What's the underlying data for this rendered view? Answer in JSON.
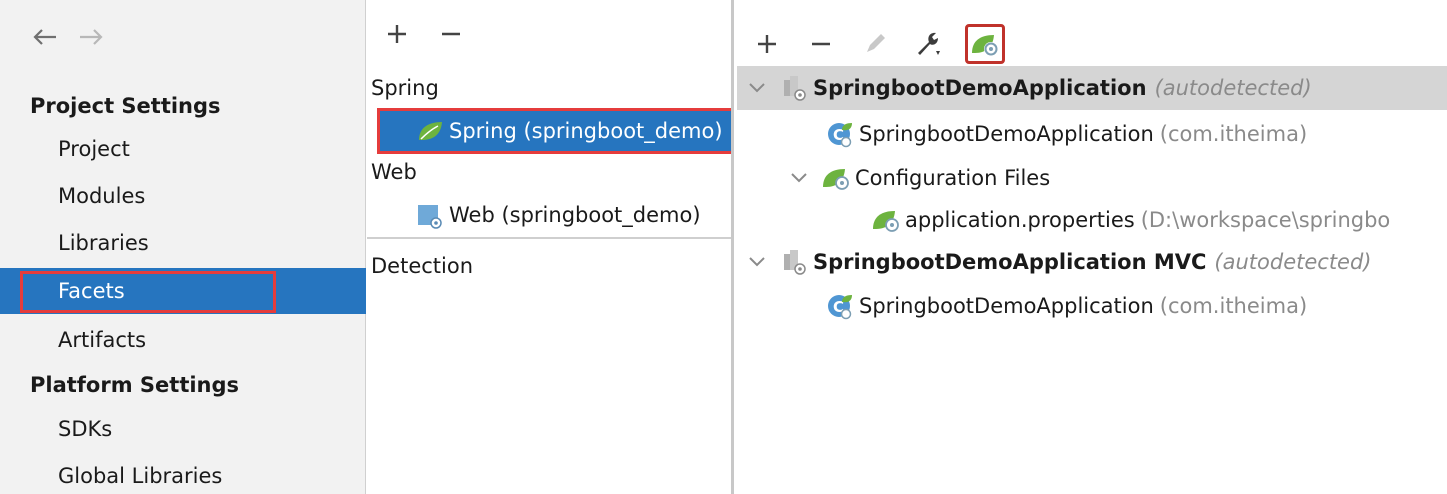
{
  "sidebar": {
    "project_settings_title": "Project Settings",
    "platform_settings_title": "Platform Settings",
    "items": [
      {
        "label": "Project"
      },
      {
        "label": "Modules"
      },
      {
        "label": "Libraries"
      },
      {
        "label": "Facets"
      },
      {
        "label": "Artifacts"
      },
      {
        "label": "SDKs"
      },
      {
        "label": "Global Libraries"
      }
    ],
    "selected": "Facets"
  },
  "middle": {
    "groups": [
      {
        "label": "Spring",
        "items": [
          {
            "label": "Spring (springboot_demo)"
          }
        ]
      },
      {
        "label": "Web",
        "items": [
          {
            "label": "Web (springboot_demo)"
          }
        ]
      }
    ],
    "detection_label": "Detection",
    "selected": "Spring (springboot_demo)"
  },
  "right": {
    "tree": [
      {
        "bold": "SpringbootDemoApplication",
        "hint": "(autodetected)"
      },
      {
        "label": "SpringbootDemoApplication",
        "hint": "(com.itheima)"
      },
      {
        "label": "Configuration Files"
      },
      {
        "label": "application.properties",
        "hint": "(D:\\workspace\\springbo"
      },
      {
        "bold": "SpringbootDemoApplication MVC",
        "hint": "(autodetected)"
      },
      {
        "label": "SpringbootDemoApplication",
        "hint": "(com.itheima)"
      }
    ]
  },
  "colors": {
    "selection_blue": "#2675bf",
    "highlight_red": "#e53c3c",
    "spring_green": "#6db33f",
    "tree_selected_gray": "#d5d5d5"
  },
  "icons": {
    "back": "arrow-left-icon",
    "forward": "arrow-right-icon",
    "add": "plus-icon",
    "remove": "minus-icon",
    "edit": "pencil-icon",
    "settings": "wrench-icon",
    "spring_config": "spring-gear-icon"
  }
}
